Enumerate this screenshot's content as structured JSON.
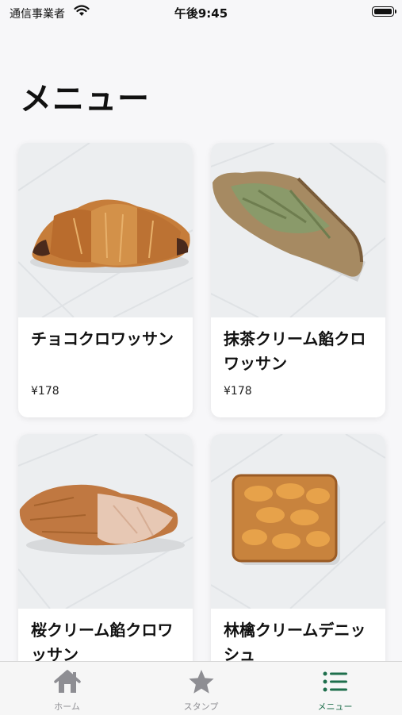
{
  "status_bar": {
    "carrier": "通信事業者",
    "time": "午後9:45"
  },
  "page": {
    "title": "メニュー"
  },
  "menu_items": [
    {
      "name": "チョコクロワッサン",
      "price": "¥178"
    },
    {
      "name": "抹茶クリーム餡クロワッサン",
      "price": "¥178"
    },
    {
      "name": "桜クリーム餡クロワッサン",
      "price": ""
    },
    {
      "name": "林檎クリームデニッシュ",
      "price": ""
    }
  ],
  "tab_bar": {
    "tabs": [
      {
        "label": "ホーム",
        "icon": "home-icon"
      },
      {
        "label": "スタンプ",
        "icon": "star-icon"
      },
      {
        "label": "メニュー",
        "icon": "list-icon"
      }
    ],
    "active_index": 2,
    "active_color": "#1e6f4c",
    "inactive_color": "#8e8e93"
  }
}
